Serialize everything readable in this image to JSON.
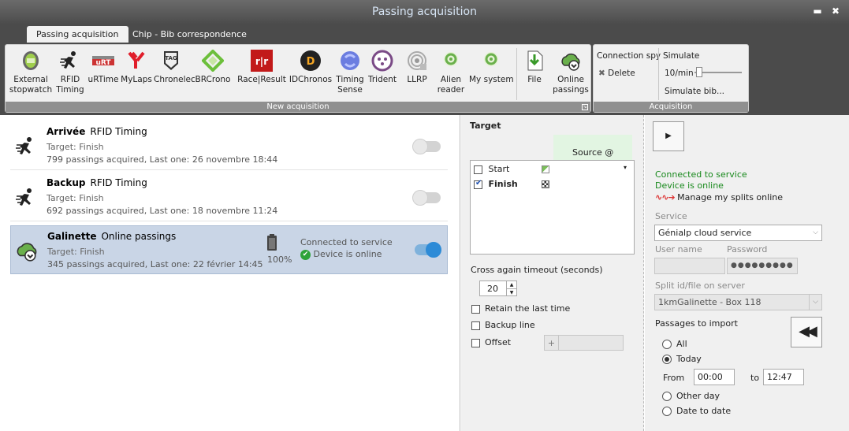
{
  "window": {
    "title": "Passing acquisition",
    "minimize_glyph": "▬",
    "close_glyph": "✖"
  },
  "tabs": [
    {
      "label": "Passing acquisition",
      "active": true
    },
    {
      "label": "Chip - Bib correspondence",
      "active": false
    }
  ],
  "ribbon": {
    "new_acquisition": {
      "label": "New acquisition",
      "buttons": [
        {
          "label": "External\nstopwatch",
          "icon": "stopwatch-icon"
        },
        {
          "label": "RFID\nTiming",
          "icon": "runner-icon"
        },
        {
          "label": "uRTime",
          "icon": "urtime-logo-icon"
        },
        {
          "label": "MyLaps",
          "icon": "mylaps-logo-icon"
        },
        {
          "label": "Chronelec",
          "icon": "tag-heuer-logo-icon"
        },
        {
          "label": "BRCrono",
          "icon": "brcrono-logo-icon"
        },
        {
          "label": "Race|Result",
          "icon": "raceresult-logo-icon"
        },
        {
          "label": "IDChronos",
          "icon": "idchronos-logo-icon"
        },
        {
          "label": "Timing\nSense",
          "icon": "timingsense-logo-icon"
        },
        {
          "label": "Trident",
          "icon": "trident-logo-icon"
        },
        {
          "label": "LLRP",
          "icon": "llrp-icon"
        },
        {
          "label": "Alien\nreader",
          "icon": "alien-reader-icon"
        },
        {
          "label": "My system",
          "icon": "my-system-icon"
        },
        {
          "label": "File",
          "icon": "file-import-icon"
        },
        {
          "label": "Online\npassings",
          "icon": "cloud-download-icon"
        }
      ]
    },
    "acquisition": {
      "label": "Acquisition",
      "connection_spy": "Connection spy",
      "delete": "Delete",
      "simulate": "Simulate",
      "rate": "10/min",
      "simulate_bib": "Simulate bib..."
    }
  },
  "acquisitions": [
    {
      "name": "Arrivée",
      "type": "RFID Timing",
      "target": "Target: Finish",
      "summary": "799 passings acquired, Last one: 26 novembre 18:44",
      "enabled": false
    },
    {
      "name": "Backup",
      "type": "RFID Timing",
      "target": "Target: Finish",
      "summary": "692 passings acquired, Last one: 18 novembre 11:24",
      "enabled": false
    },
    {
      "name": "Galinette",
      "type": "Online passings",
      "target": "Target: Finish",
      "summary": "345 passings acquired, Last one: 22 février 14:45",
      "battery": "100%",
      "status1": "Connected to service",
      "status2": "Device is online",
      "enabled": true
    }
  ],
  "target": {
    "title": "Target",
    "source_header": "Source @",
    "items": [
      {
        "label": "Start",
        "checked": false
      },
      {
        "label": "Finish",
        "checked": true
      }
    ],
    "cross_timeout_label": "Cross again timeout (seconds)",
    "cross_timeout_value": "20",
    "retain_last": "Retain the last time",
    "backup_line": "Backup line",
    "offset": "Offset",
    "offset_sign": "+"
  },
  "service_panel": {
    "status_connected": "Connected to service",
    "status_online": "Device is online",
    "manage_link": "Manage my splits online",
    "service_label": "Service",
    "service_value": "Génialp cloud service",
    "username_label": "User name",
    "password_label": "Password",
    "password_value": "●●●●●●●●●",
    "split_label": "Split id/file on server",
    "split_value": "1kmGalinette - Box 118",
    "passages_label": "Passages to import",
    "opt_all": "All",
    "opt_today": "Today",
    "from_label": "From",
    "from_value": "00:00",
    "to_label": "to",
    "to_value": "12:47",
    "opt_other_day": "Other day",
    "opt_date_to_date": "Date to date"
  },
  "colors": {
    "accent_blue": "#2d8bd7",
    "status_green": "#18891c",
    "dark_chrome": "#4b4b4b"
  }
}
